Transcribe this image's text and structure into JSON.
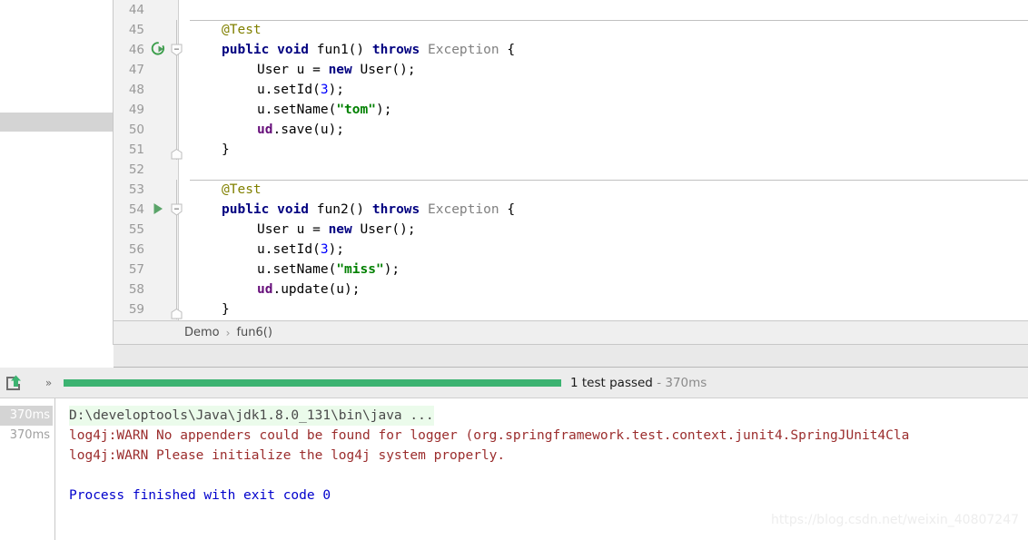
{
  "editor": {
    "lines": [
      {
        "no": "44",
        "indent": 0,
        "text": "",
        "tokens": [],
        "sep_above": false,
        "gutter_icon": "none",
        "fold": "none"
      },
      {
        "no": "45",
        "indent": 0,
        "text": "@Test",
        "tokens": [
          {
            "t": "@Test",
            "c": "anno"
          }
        ],
        "sep_above": true,
        "gutter_icon": "none",
        "fold": "line"
      },
      {
        "no": "46",
        "indent": 0,
        "text": "public void fun1() throws Exception {",
        "tokens": [
          {
            "t": "public void",
            "c": "kw"
          },
          {
            "t": " ",
            "c": "plain"
          },
          {
            "t": "fun1()",
            "c": "plain"
          },
          {
            "t": " ",
            "c": "plain"
          },
          {
            "t": "throws",
            "c": "kw"
          },
          {
            "t": " ",
            "c": "plain"
          },
          {
            "t": "Exception",
            "c": "dim"
          },
          {
            "t": " {",
            "c": "plain"
          }
        ],
        "sep_above": false,
        "gutter_icon": "rerun-test",
        "fold": "collapse"
      },
      {
        "no": "47",
        "indent": 1,
        "text": "User u = new User();",
        "tokens": [
          {
            "t": "User u = ",
            "c": "plain"
          },
          {
            "t": "new",
            "c": "kw"
          },
          {
            "t": " User();",
            "c": "plain"
          }
        ],
        "sep_above": false,
        "gutter_icon": "none",
        "fold": "line"
      },
      {
        "no": "48",
        "indent": 1,
        "text": "u.setId(3);",
        "tokens": [
          {
            "t": "u.setId(",
            "c": "plain"
          },
          {
            "t": "3",
            "c": "num"
          },
          {
            "t": ");",
            "c": "plain"
          }
        ],
        "sep_above": false,
        "gutter_icon": "none",
        "fold": "line"
      },
      {
        "no": "49",
        "indent": 1,
        "text": "u.setName(\"tom\");",
        "tokens": [
          {
            "t": "u.setName(",
            "c": "plain"
          },
          {
            "t": "\"tom\"",
            "c": "str"
          },
          {
            "t": ");",
            "c": "plain"
          }
        ],
        "sep_above": false,
        "gutter_icon": "none",
        "fold": "line"
      },
      {
        "no": "50",
        "indent": 1,
        "text": "ud.save(u);",
        "tokens": [
          {
            "t": "ud",
            "c": "field"
          },
          {
            "t": ".save(u);",
            "c": "plain"
          }
        ],
        "sep_above": false,
        "gutter_icon": "none",
        "fold": "line"
      },
      {
        "no": "51",
        "indent": 0,
        "text": "}",
        "tokens": [
          {
            "t": "}",
            "c": "plain"
          }
        ],
        "sep_above": false,
        "gutter_icon": "none",
        "fold": "end"
      },
      {
        "no": "52",
        "indent": 0,
        "text": "",
        "tokens": [],
        "sep_above": false,
        "gutter_icon": "none",
        "fold": "none"
      },
      {
        "no": "53",
        "indent": 0,
        "text": "@Test",
        "tokens": [
          {
            "t": "@Test",
            "c": "anno"
          }
        ],
        "sep_above": true,
        "gutter_icon": "none",
        "fold": "line"
      },
      {
        "no": "54",
        "indent": 0,
        "text": "public void fun2() throws Exception {",
        "tokens": [
          {
            "t": "public void",
            "c": "kw"
          },
          {
            "t": " ",
            "c": "plain"
          },
          {
            "t": "fun2()",
            "c": "plain"
          },
          {
            "t": " ",
            "c": "plain"
          },
          {
            "t": "throws",
            "c": "kw"
          },
          {
            "t": " ",
            "c": "plain"
          },
          {
            "t": "Exception",
            "c": "dim"
          },
          {
            "t": " {",
            "c": "plain"
          }
        ],
        "sep_above": false,
        "gutter_icon": "run-test",
        "fold": "collapse"
      },
      {
        "no": "55",
        "indent": 1,
        "text": "User u = new User();",
        "tokens": [
          {
            "t": "User u = ",
            "c": "plain"
          },
          {
            "t": "new",
            "c": "kw"
          },
          {
            "t": " User();",
            "c": "plain"
          }
        ],
        "sep_above": false,
        "gutter_icon": "none",
        "fold": "line"
      },
      {
        "no": "56",
        "indent": 1,
        "text": "u.setId(3);",
        "tokens": [
          {
            "t": "u.setId(",
            "c": "plain"
          },
          {
            "t": "3",
            "c": "num"
          },
          {
            "t": ");",
            "c": "plain"
          }
        ],
        "sep_above": false,
        "gutter_icon": "none",
        "fold": "line"
      },
      {
        "no": "57",
        "indent": 1,
        "text": "u.setName(\"miss\");",
        "tokens": [
          {
            "t": "u.setName(",
            "c": "plain"
          },
          {
            "t": "\"miss\"",
            "c": "str"
          },
          {
            "t": ");",
            "c": "plain"
          }
        ],
        "sep_above": false,
        "gutter_icon": "none",
        "fold": "line"
      },
      {
        "no": "58",
        "indent": 1,
        "text": "ud.update(u);",
        "tokens": [
          {
            "t": "ud",
            "c": "field"
          },
          {
            "t": ".update(u);",
            "c": "plain"
          }
        ],
        "sep_above": false,
        "gutter_icon": "none",
        "fold": "line"
      },
      {
        "no": "59",
        "indent": 0,
        "text": "}",
        "tokens": [
          {
            "t": "}",
            "c": "plain"
          }
        ],
        "sep_above": false,
        "gutter_icon": "none",
        "fold": "end"
      }
    ]
  },
  "breadcrumb": {
    "items": [
      "Demo",
      "fun6()"
    ],
    "separator": "›"
  },
  "run_panel": {
    "export_icon": "export-to-file-icon",
    "expand_icon": "chevrons-right-icon",
    "progress_percent": 100,
    "status_text": "1 test passed",
    "status_duration": "- 370ms",
    "timestamps": [
      "370ms",
      "370ms"
    ],
    "console_lines": [
      {
        "text": "D:\\developtools\\Java\\jdk1.8.0_131\\bin\\java ...",
        "style": "c-cmd"
      },
      {
        "text": "log4j:WARN No appenders could be found for logger (org.springframework.test.context.junit4.SpringJUnit4Cla",
        "style": "c-warn"
      },
      {
        "text": "log4j:WARN Please initialize the log4j system properly.",
        "style": "c-warn"
      },
      {
        "text": "",
        "style": "c-warn"
      },
      {
        "text": "Process finished with exit code 0",
        "style": "c-final"
      }
    ]
  },
  "watermark": {
    "text": "https://blog.csdn.net/weixin_40807247"
  },
  "colors": {
    "accent_green": "#3cb371",
    "warn_red": "#9b2d2d",
    "exit_blue": "#0000cc",
    "gutter_bg": "#f2f2f2"
  }
}
